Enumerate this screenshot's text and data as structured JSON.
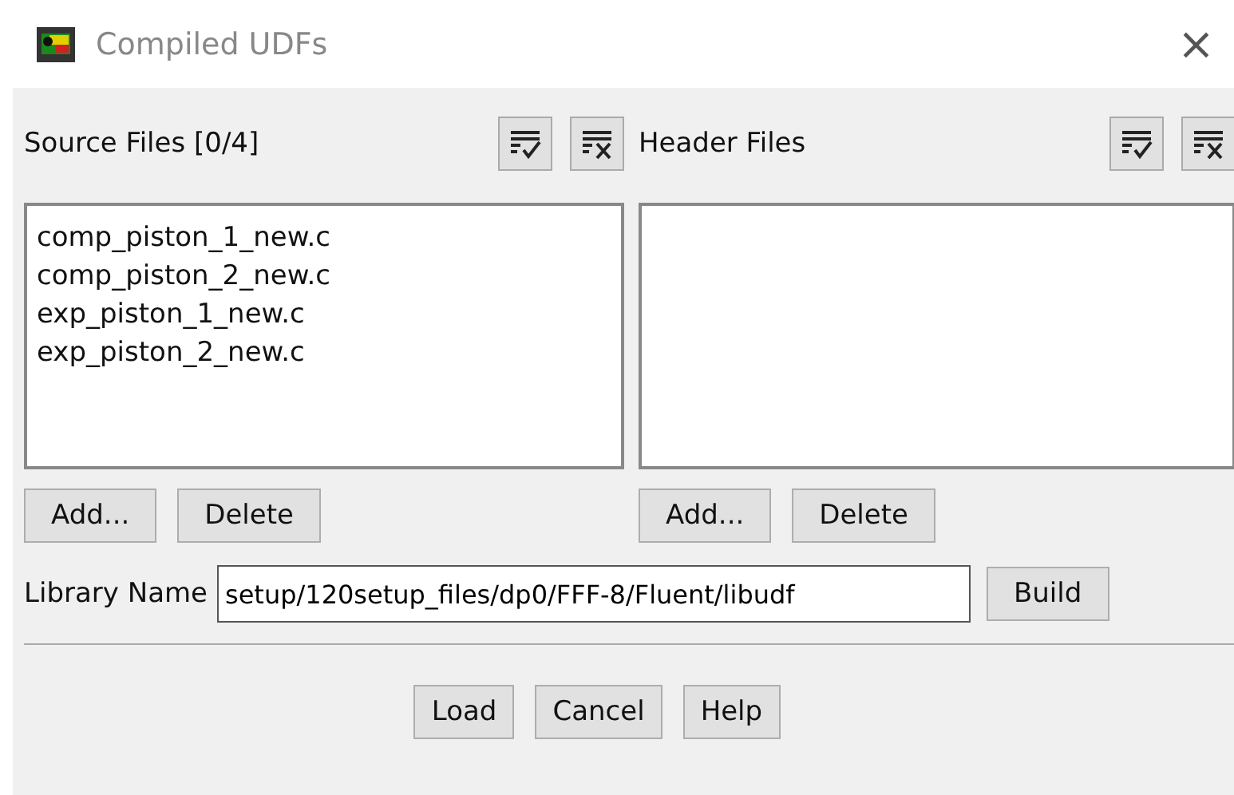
{
  "window": {
    "title": "Compiled UDFs",
    "close": "×"
  },
  "source_files": {
    "label": "Source Files [0/4]",
    "items": [
      {
        "name": "comp_piston_1_new.c",
        "selected": false
      },
      {
        "name": "comp_piston_2_new.c",
        "selected": false
      },
      {
        "name": "exp_piston_1_new.c",
        "selected": false
      },
      {
        "name": "exp_piston_2_new.c",
        "selected": false
      }
    ],
    "buttons": [
      "Add...",
      "Delete"
    ]
  },
  "header_files": {
    "label": "Header Files",
    "buttons": [
      "Add...",
      "Delete"
    ]
  },
  "library": {
    "label": "Library Name",
    "value": "setup/120setup_files/dp0/FFF-8/Fluent/libudf",
    "button": "Build"
  },
  "buttons": [
    "Load",
    "Cancel",
    "Help"
  ]
}
